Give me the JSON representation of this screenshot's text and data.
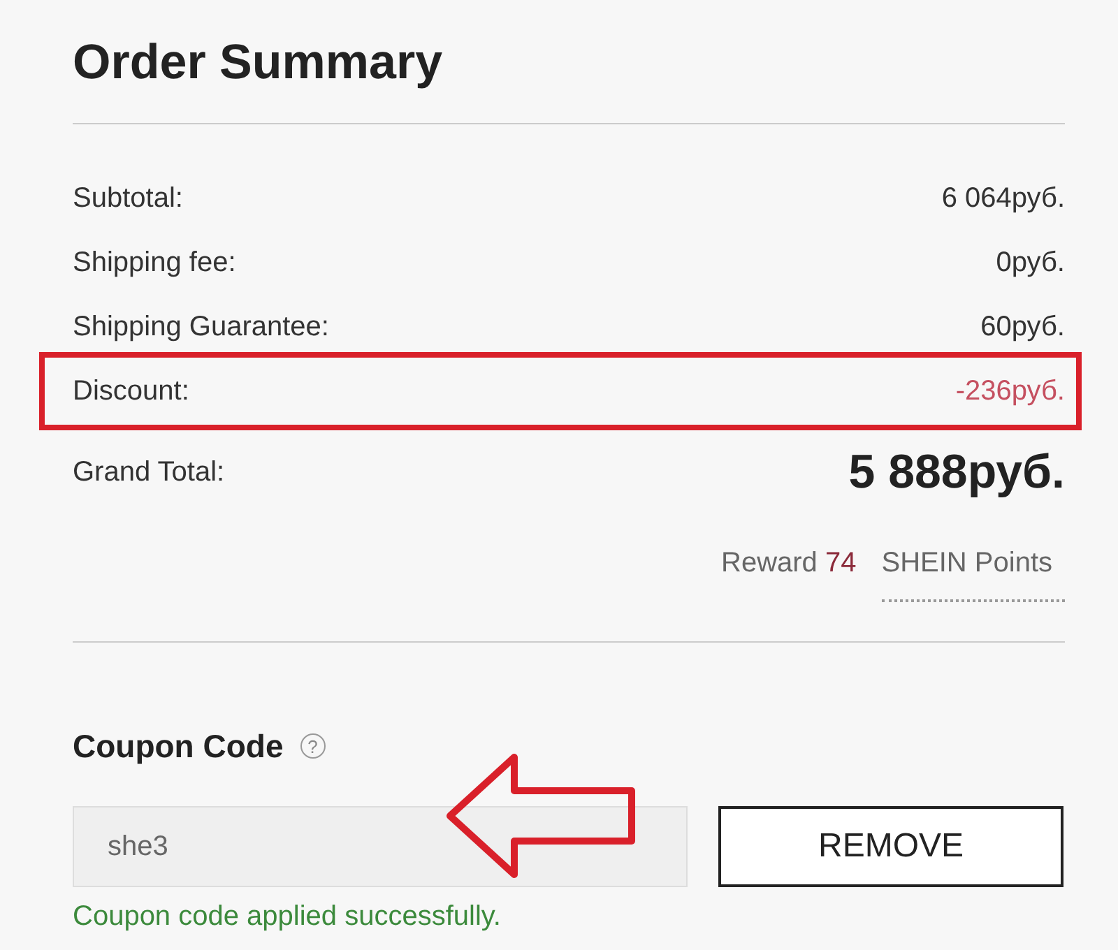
{
  "title": "Order Summary",
  "rows": [
    {
      "label": "Subtotal:",
      "value": "6 064руб.",
      "kind": "normal",
      "highlighted": false
    },
    {
      "label": "Shipping fee:",
      "value": "0руб.",
      "kind": "normal",
      "highlighted": false
    },
    {
      "label": "Shipping Guarantee:",
      "value": "60руб.",
      "kind": "normal",
      "highlighted": false
    },
    {
      "label": "Discount:",
      "value": "-236руб.",
      "kind": "discount",
      "highlighted": true
    }
  ],
  "grand_total": {
    "label": "Grand Total:",
    "value": "5 888руб."
  },
  "reward": {
    "prefix": "Reward",
    "points": "74",
    "unit": "SHEIN Points"
  },
  "coupon": {
    "title": "Coupon Code",
    "help_icon": "?",
    "value": "she3",
    "button": "REMOVE",
    "message": "Coupon code applied successfully."
  }
}
